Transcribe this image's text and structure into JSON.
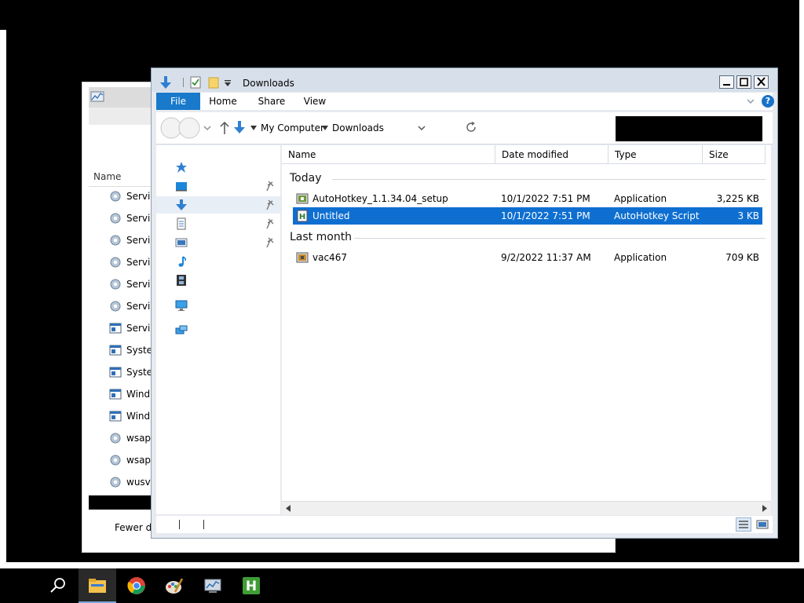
{
  "window": {
    "title": "Downloads",
    "buttons": {
      "minimize": "_",
      "maximize": "□",
      "close": "✕"
    }
  },
  "ribbon": {
    "tabs": [
      {
        "label": "File"
      },
      {
        "label": "Home"
      },
      {
        "label": "Share"
      },
      {
        "label": "View"
      }
    ],
    "help": "?"
  },
  "address": {
    "breadcrumb": [
      "My Computer",
      "Downloads"
    ],
    "search_value": ""
  },
  "nav_pane": {
    "items": [
      {
        "icon": "quick-access-star-icon",
        "pinned": false
      },
      {
        "icon": "desktop-icon",
        "pinned": true
      },
      {
        "icon": "downloads-arrow-icon",
        "pinned": true,
        "selected": true
      },
      {
        "icon": "documents-icon",
        "pinned": true
      },
      {
        "icon": "pictures-icon",
        "pinned": true
      },
      {
        "icon": "music-note-icon",
        "pinned": false
      },
      {
        "icon": "videos-icon",
        "pinned": false
      },
      {
        "icon": "this-pc-icon",
        "pinned": false
      },
      {
        "icon": "network-icon",
        "pinned": false
      }
    ]
  },
  "columns": {
    "name": "Name",
    "date": "Date modified",
    "type": "Type",
    "size": "Size"
  },
  "groups": [
    {
      "label": "Today",
      "files": [
        {
          "name": "AutoHotkey_1.1.34.04_setup",
          "date": "10/1/2022 7:51 PM",
          "type": "Application",
          "size": "3,225 KB",
          "icon": "installer-icon",
          "selected": false
        },
        {
          "name": "Untitled",
          "date": "10/1/2022 7:51 PM",
          "type": "AutoHotkey Script",
          "size": "3 KB",
          "icon": "ahk-script-icon",
          "selected": true
        }
      ]
    },
    {
      "label": "Last month",
      "files": [
        {
          "name": "vac467",
          "date": "9/2/2022 11:37 AM",
          "type": "Application",
          "size": "709 KB",
          "icon": "application-icon",
          "selected": false
        }
      ]
    }
  ],
  "background_window": {
    "column_header": "Name",
    "rows": [
      "Servic",
      "Servic",
      "Servic",
      "Servic",
      "Servic",
      "Servic",
      "Servic",
      "Syste",
      "Syste",
      "Wind",
      "Wind",
      "wsap",
      "wsap",
      "wusv"
    ],
    "footer": "Fewer de"
  },
  "taskbar": {
    "items": [
      "search-icon",
      "file-explorer-icon",
      "chrome-icon",
      "paint-icon",
      "performance-monitor-icon",
      "autohotkey-icon"
    ]
  },
  "colors": {
    "selection": "#0f6fd1",
    "file_tab": "#1979ca",
    "title_bar": "#d7e0ea"
  }
}
